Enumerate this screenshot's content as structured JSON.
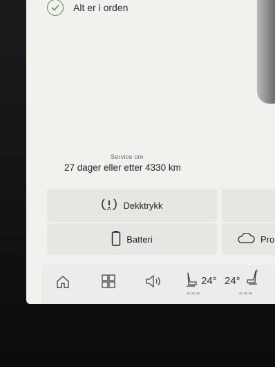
{
  "status": {
    "text": "Alt er i orden",
    "icon": "check-circle-icon"
  },
  "service": {
    "label": "Service om",
    "value": "27 dager eller etter 4330 km"
  },
  "tiles": {
    "tyre_pressure": {
      "label": "Dekktrykk",
      "icon": "tyre-pressure-warning-icon"
    },
    "battery": {
      "label": "Batteri",
      "icon": "battery-icon"
    },
    "profile": {
      "label": "Pro",
      "icon": "cloud-icon"
    }
  },
  "tray": {
    "home_icon": "home-icon",
    "apps_icon": "apps-grid-icon",
    "volume_icon": "volume-icon",
    "seat_left_icon": "seat-heat-left-icon",
    "temp_left": "24°",
    "temp_right": "24°",
    "seat_right_icon": "seat-heat-right-icon"
  },
  "colors": {
    "screen_bg": "#f1f1ee",
    "tile_bg": "#e6e6e3",
    "ok_green": "#5d8a62"
  }
}
